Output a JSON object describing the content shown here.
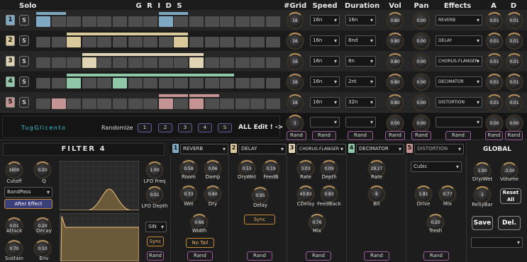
{
  "header": {
    "solo": "Solo",
    "grids": "G R I D S",
    "ngrid": "#Grid",
    "speed": "Speed",
    "duration": "Duration",
    "vol": "Vol",
    "pan": "Pan",
    "effects": "Effects",
    "a": "A",
    "d": "D"
  },
  "tracks": [
    {
      "num": "1",
      "solo": "S",
      "color": "#7fa9c2",
      "bar": "#7fa9c2",
      "grid": "16",
      "speed": "16n",
      "duration": "16n",
      "vol": "0.80",
      "pan": "0.00",
      "effect": "REVERB",
      "a": "0.01",
      "d": "0.01"
    },
    {
      "num": "2",
      "solo": "S",
      "color": "#d8c89a",
      "bar": "#d8c89a",
      "grid": "16",
      "speed": "16n",
      "duration": "8nd",
      "vol": "0.80",
      "pan": "0.00",
      "effect": "DELAY",
      "a": "0.01",
      "d": "0.01"
    },
    {
      "num": "3",
      "solo": "S",
      "color": "#e0d4b4",
      "bar": "#e0d4b4",
      "grid": "16",
      "speed": "16n",
      "duration": "8n",
      "vol": "0.80",
      "pan": "0.00",
      "effect": "CHORUS-FLANGER",
      "a": "0.01",
      "d": "0.01"
    },
    {
      "num": "4",
      "solo": "S",
      "color": "#8fc7a8",
      "bar": "#8fc7a8",
      "grid": "16",
      "speed": "16n",
      "duration": "2nt",
      "vol": "0.80",
      "pan": "0.00",
      "effect": "DECIMATOR",
      "a": "0.01",
      "d": "0.01"
    },
    {
      "num": "5",
      "solo": "S",
      "color": "#c49494",
      "bar": "#c49494",
      "grid": "16",
      "speed": "16n",
      "duration": "32n",
      "vol": "0.80",
      "pan": "0.00",
      "effect": "DISTORTION",
      "a": "0.01",
      "d": "0.01"
    }
  ],
  "randomize": {
    "title": "TugGlicento",
    "label": "Randomize",
    "buttons": [
      "1",
      "2",
      "3",
      "4",
      "S"
    ],
    "alledit": "ALL Edit ! ->",
    "grid": "1",
    "vol": "0.00",
    "pan": "0.00",
    "a": "0.00",
    "d": "0.00",
    "rand": "Rand"
  },
  "filter": {
    "title": "FILTER 4",
    "cutoff_val": "1600",
    "cutoff": "Cutoff",
    "q_val": "0.20",
    "q": "Q",
    "type": "BandPass",
    "after": "After Effect",
    "lfo_freq_val": "1.00",
    "lfo_freq": "LFO Freq",
    "lfo_depth_val": "0.01",
    "lfo_depth": "LFO Depth",
    "attack_val": "0.01",
    "attack": "Attack",
    "decay_val": "0.20",
    "decay": "Decay",
    "sustain_val": "0.70",
    "sustain": "Sustain",
    "env_val": "0.10",
    "env": "Env",
    "wave": "SIN",
    "sync": "Sync",
    "rand": "Rand"
  },
  "fx": [
    {
      "num": "1",
      "name": "REVERB",
      "color": "#7fa9c2"
    },
    {
      "num": "2",
      "name": "DELAY",
      "color": "#d8c89a"
    },
    {
      "num": "3",
      "name": "CHORUS-FLANGER",
      "color": "#e0d4b4"
    },
    {
      "num": "4",
      "name": "DECIMATOR",
      "color": "#8fc7a8"
    },
    {
      "num": "5",
      "name": "DISTORTION",
      "color": "#c49494"
    }
  ],
  "reverb": {
    "room_val": "0.58",
    "room": "Room",
    "damp_val": "0.06",
    "damp": "Damp",
    "wet_val": "0.33",
    "wet": "Wet",
    "dry_val": "0.60",
    "dry": "Dry",
    "width_val": "0.66",
    "width": "Width",
    "notail": "No Tail",
    "rand": "Rand"
  },
  "delay": {
    "drywet_val": "0.53",
    "drywet": "DryWet",
    "feedb_val": "0.19",
    "feedb": "FeedB",
    "delay_val": "0.95",
    "delay": "Delay",
    "sync": "Sync",
    "rand": "Rand"
  },
  "chorus": {
    "rate_val": "3.03",
    "rate": "Rate",
    "depth_val": "0.09",
    "depth": "Depth",
    "cdelay_val": "43.83",
    "cdelay": "CDelay",
    "feedback_val": "0.83",
    "feedback": "FeedBack",
    "mix_val": "0.76",
    "mix": "Mix",
    "rand": "Rand"
  },
  "decimator": {
    "rate_val": "29.27",
    "rate": "Rate",
    "bit_val": "6",
    "bit": "Bit",
    "rand": "Rand"
  },
  "distortion": {
    "type": "Cubic",
    "drive_val": "1.81",
    "drive": "Drive",
    "mix_val": "0.77",
    "mix": "Mix",
    "tresh_val": "0.20",
    "tresh": "Tresh",
    "rand": "Rand"
  },
  "global": {
    "title": "GLOBAL",
    "drywet_val": "1.00",
    "drywet": "Dry/Wet",
    "volume_val": "-3.00",
    "volume": "Volume",
    "resybar_val": "1",
    "resybar": "ReSyBar",
    "reset": "Reset All",
    "save": "Save",
    "del": "Del."
  },
  "colors": {
    "accent": "#c88a30",
    "rand_border": "#9b5a9b",
    "cyan": "#3fc3d8"
  }
}
